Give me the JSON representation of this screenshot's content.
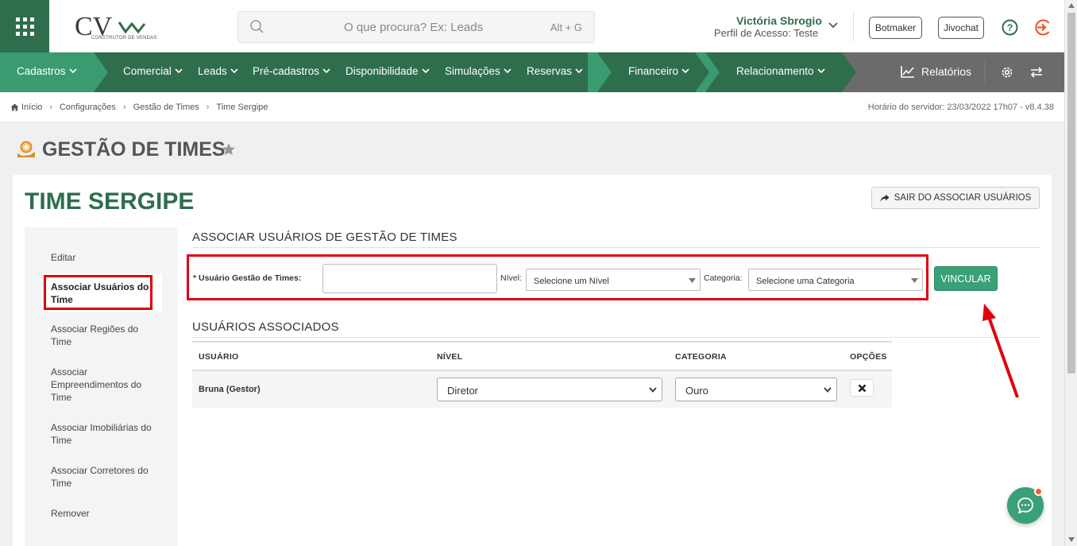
{
  "header": {
    "logo_text": "CV",
    "logo_subtitle": "CONSTRUTOR DE VENDAS",
    "search_placeholder": "O que procura? Ex: Leads",
    "search_shortcut": "Alt + G",
    "user_name": "Victória Sbrogio",
    "user_profile": "Perfil de Acesso: Teste",
    "botmaker_label": "Botmaker",
    "jivochat_label": "Jivochat"
  },
  "nav": {
    "items": [
      {
        "label": "Cadastros"
      },
      {
        "label": "Comercial"
      },
      {
        "label": "Leads"
      },
      {
        "label": "Pré-cadastros"
      },
      {
        "label": "Disponibilidade"
      },
      {
        "label": "Simulações"
      },
      {
        "label": "Reservas"
      },
      {
        "label": "Financeiro"
      },
      {
        "label": "Relacionamento"
      }
    ],
    "reports_label": "Relatórios"
  },
  "breadcrumb": {
    "items": [
      "Início",
      "Configurações",
      "Gestão de Times",
      "Time Sergipe"
    ],
    "server_time": "Horário do servidor: 23/03/2022 17h07 - v8.4.38"
  },
  "page": {
    "title": "GESTÃO DE TIMES",
    "team_title": "TIME SERGIPE",
    "exit_button": "SAIR DO ASSOCIAR USUÁRIOS"
  },
  "sidebar": {
    "items": [
      {
        "label": "Editar"
      },
      {
        "label": "Associar Usuários do Time",
        "active": true
      },
      {
        "label": "Associar Regiões do Time"
      },
      {
        "label": "Associar Empreendimentos do Time"
      },
      {
        "label": "Associar Imobiliárias do Time"
      },
      {
        "label": "Associar Corretores do Time"
      },
      {
        "label": "Remover"
      }
    ]
  },
  "form": {
    "section_title": "ASSOCIAR USUÁRIOS DE GESTÃO DE TIMES",
    "user_label": "* Usuário Gestão de Times:",
    "user_value": "",
    "level_label": "Nível:",
    "level_value": "Selecione um Nível",
    "category_label": "Categoria:",
    "category_value": "Selecione uma Categoria",
    "submit_label": "VINCULAR"
  },
  "associated": {
    "section_title": "USUÁRIOS ASSOCIADOS",
    "columns": [
      "USUÁRIO",
      "NÍVEL",
      "CATEGORIA",
      "OPÇÕES"
    ],
    "rows": [
      {
        "user": "Bruna (Gestor)",
        "level": "Diretor",
        "category": "Ouro"
      }
    ]
  },
  "colors": {
    "brand_green": "#2e6e4c",
    "button_green": "#3aa078",
    "highlight_red": "#e0000d"
  }
}
